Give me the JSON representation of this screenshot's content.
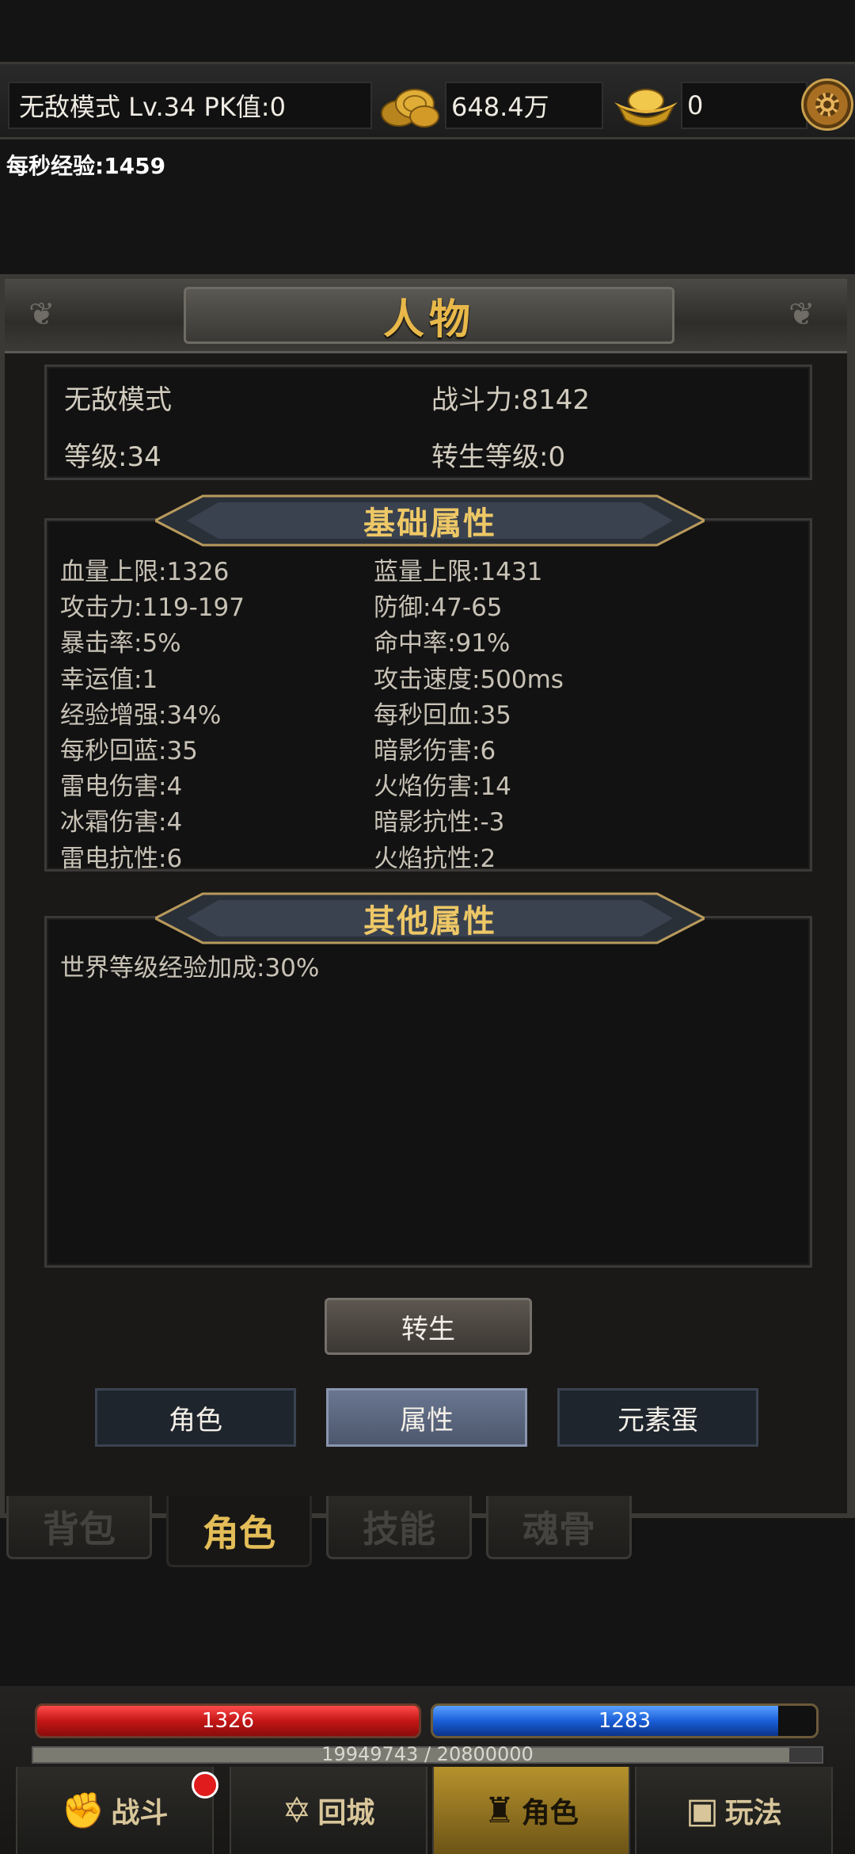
{
  "topbar": {
    "mode_label": "无敌模式  Lv.34 PK值:0",
    "gold": "648.4万",
    "ingot": "0"
  },
  "exp_rate": "每秒经验:1459",
  "panel": {
    "title": "人物",
    "summary": {
      "name": "无敌模式",
      "power": "战斗力:8142",
      "level": "等级:34",
      "rebirth_level": "转生等级:0"
    },
    "basic_title": "基础属性",
    "basic_stats": [
      [
        "血量上限:1326",
        "蓝量上限:1431"
      ],
      [
        "攻击力:119-197",
        "防御:47-65"
      ],
      [
        "暴击率:5%",
        "命中率:91%"
      ],
      [
        "幸运值:1",
        "攻击速度:500ms"
      ],
      [
        "经验增强:34%",
        "每秒回血:35"
      ],
      [
        "每秒回蓝:35",
        "暗影伤害:6"
      ],
      [
        "雷电伤害:4",
        "火焰伤害:14"
      ],
      [
        "冰霜伤害:4",
        "暗影抗性:-3"
      ],
      [
        "雷电抗性:6",
        "火焰抗性:2"
      ]
    ],
    "other_title": "其他属性",
    "other_stats": [
      "世界等级经验加成:30%"
    ],
    "rebirth_button": "转生",
    "sub_tabs": [
      "角色",
      "属性",
      "元素蛋"
    ],
    "active_sub_tab": 1
  },
  "lower_tabs": [
    "背包",
    "角色",
    "技能",
    "魂骨"
  ],
  "active_lower_tab": 1,
  "hud": {
    "hp": "1326",
    "mp": "1283",
    "mp_fraction": 0.9,
    "exp": "19949743 / 20800000",
    "exp_fraction": 0.959
  },
  "nav": [
    {
      "label": "战斗",
      "icon": "fist-icon"
    },
    {
      "label": "回城",
      "icon": "portal-icon"
    },
    {
      "label": "角色",
      "icon": "helmet-icon"
    },
    {
      "label": "玩法",
      "icon": "chest-icon"
    }
  ],
  "active_nav": 2
}
